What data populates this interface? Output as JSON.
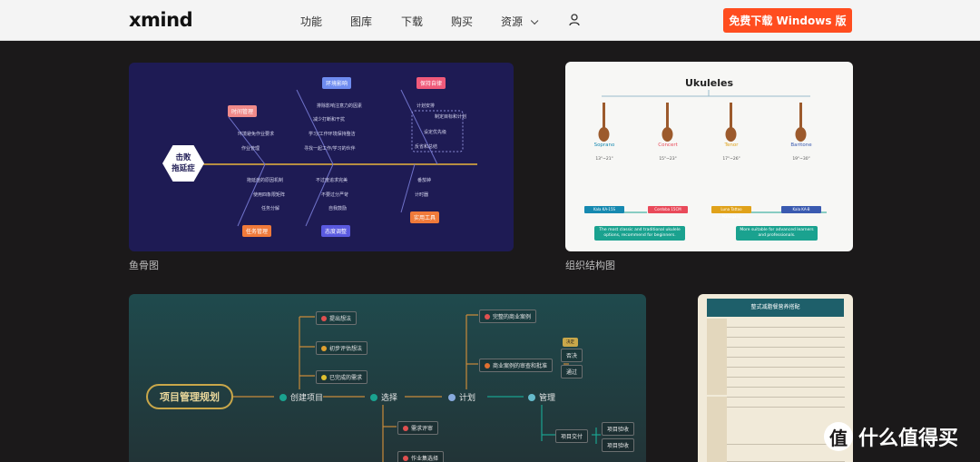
{
  "header": {
    "logo": "xmind",
    "nav": [
      "功能",
      "图库",
      "下载",
      "购买",
      "资源"
    ],
    "download_button": "免费下载 Windows 版"
  },
  "cards": {
    "fishbone": {
      "caption": "鱼骨图",
      "center": "击败拖延症",
      "boxes": [
        "时间管理",
        "环境影响",
        "保持自律",
        "任务管理",
        "态度调整",
        "实用工具"
      ],
      "details": {
        "time": [
          "环境避免作业要求",
          "作业管理"
        ],
        "env": [
          "排除影响注意力的因素",
          "减少打断和干扰",
          "学习/工作环境保持整洁",
          "寻找一起工作/学习的伙伴"
        ],
        "disc": [
          "计划安排",
          "制定目标和计划",
          "设定优先级",
          "反省和总结"
        ],
        "task": [
          "拖延症的原因机制",
          "使用四象限矩阵",
          "任务分解"
        ],
        "attitude": [
          "不过度追求完美",
          "不要过分严苛",
          "自我鼓励"
        ],
        "tools": [
          "番茄钟",
          "计时器"
        ]
      }
    },
    "ukulele": {
      "caption": "组织结构图",
      "title": "Ukuleles",
      "types": [
        {
          "name": "Soprano",
          "range": "13\"~21\"",
          "tag": "Kala KA-15S"
        },
        {
          "name": "Concert",
          "range": "15\"~23\"",
          "tag": "Cordoba 15CM"
        },
        {
          "name": "Tenor",
          "range": "17\"~26\"",
          "tag": "Luna Tattoo Mahogany"
        },
        {
          "name": "Baritone",
          "range": "19\"~30\"",
          "tag": "Kala KA-B"
        }
      ],
      "notes": [
        "The most classic and traditional ukulele options, recommend for beginners.",
        "More suitable for advanced learners and professionals."
      ]
    },
    "project": {
      "root": "项目管理规划",
      "main": [
        "创建项目",
        "选择",
        "计划",
        "管理"
      ],
      "ideas": [
        "提出想法",
        "初步评估想法",
        "已完成的需求"
      ],
      "top": [
        "完整的商业案例",
        "商业案例的审查和批准"
      ],
      "decision": [
        "决定",
        "否决",
        "通过"
      ],
      "bottom": [
        "需求评审",
        "作业集选择"
      ],
      "manage": [
        "项目交付",
        "项目验收",
        "项目验收"
      ]
    },
    "table": {
      "title": "整式减脂餐营养搭配"
    }
  },
  "watermark": {
    "icon_text": "值",
    "text": "什么值得买"
  },
  "colors": {
    "accent": "#ff4d1f",
    "page_bg": "#1b191a"
  }
}
